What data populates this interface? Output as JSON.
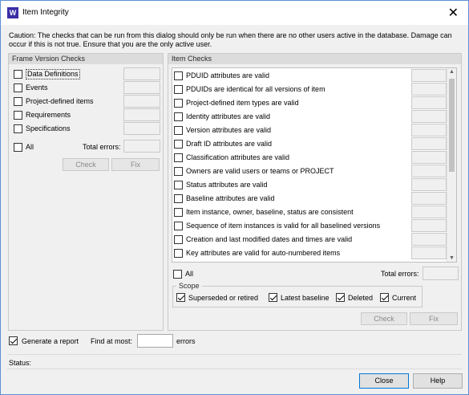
{
  "window": {
    "title": "Item Integrity",
    "app_icon_letter": "W"
  },
  "caution": "Caution: The checks that can be run from this dialog should only be run when there are no other users active in the database. Damage can occur if this is not true. Ensure that you are the only active user.",
  "frame": {
    "header": "Frame Version Checks",
    "items": [
      {
        "label": "Data Definitions",
        "checked": false
      },
      {
        "label": "Events",
        "checked": false
      },
      {
        "label": "Project-defined items",
        "checked": false
      },
      {
        "label": "Requirements",
        "checked": false
      },
      {
        "label": "Specifications",
        "checked": false
      }
    ],
    "all_label": "All",
    "total_errors_label": "Total errors:",
    "check_label": "Check",
    "fix_label": "Fix"
  },
  "item_checks": {
    "header": "Item Checks",
    "items": [
      {
        "label": "PDUID attributes are valid",
        "checked": false
      },
      {
        "label": "PDUIDs are identical for all versions of item",
        "checked": false
      },
      {
        "label": "Project-defined item types are valid",
        "checked": false
      },
      {
        "label": "Identity attributes are valid",
        "checked": false
      },
      {
        "label": "Version attributes are valid",
        "checked": false
      },
      {
        "label": "Draft ID attributes are valid",
        "checked": false
      },
      {
        "label": "Classification attributes are valid",
        "checked": false
      },
      {
        "label": "Owners are valid users or teams or PROJECT",
        "checked": false
      },
      {
        "label": "Status attributes are valid",
        "checked": false
      },
      {
        "label": "Baseline attributes are valid",
        "checked": false
      },
      {
        "label": "Item instance, owner, baseline, status are consistent",
        "checked": false
      },
      {
        "label": "Sequence of item instances is valid for all baselined versions",
        "checked": false
      },
      {
        "label": "Creation and last modified dates and times are valid",
        "checked": false
      },
      {
        "label": "Key attributes are valid for auto-numbered items",
        "checked": false
      }
    ],
    "all_label": "All",
    "total_errors_label": "Total errors:",
    "scope": {
      "title": "Scope",
      "options": [
        {
          "label": "Superseded or retired",
          "checked": true
        },
        {
          "label": "Latest baseline",
          "checked": true
        },
        {
          "label": "Deleted",
          "checked": true
        },
        {
          "label": "Current",
          "checked": true
        }
      ]
    },
    "check_label": "Check",
    "fix_label": "Fix"
  },
  "footer": {
    "generate_report_label": "Generate a report",
    "generate_report_checked": true,
    "find_at_most_label": "Find at most:",
    "find_at_most_value": "",
    "errors_label": "errors",
    "status_label": "Status:",
    "close_label": "Close",
    "help_label": "Help"
  }
}
